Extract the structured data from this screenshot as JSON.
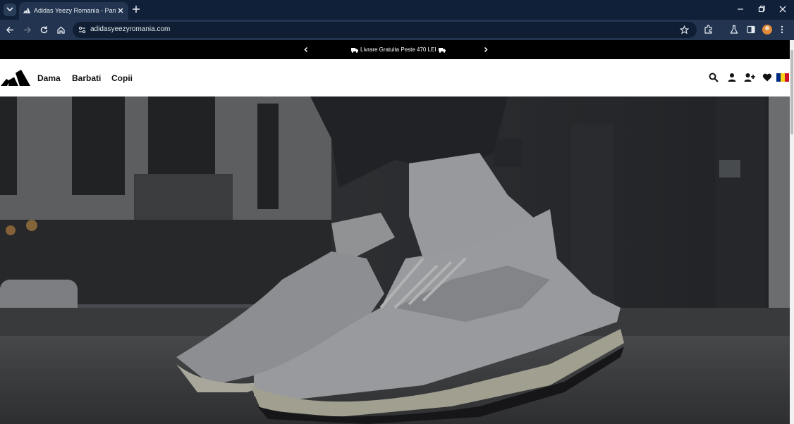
{
  "browser": {
    "tab_title": "Adidas Yeezy Romania - Pantofi",
    "url": "adidasyeezyromania.com"
  },
  "promo": {
    "text": "Livrare Gratuita Peste 470 LEI"
  },
  "nav": {
    "items": [
      "Dama",
      "Barbati",
      "Copii"
    ]
  },
  "colors": {
    "promo_bg": "#000000",
    "flag": [
      "#002b7f",
      "#fcd116",
      "#ce1126"
    ]
  }
}
